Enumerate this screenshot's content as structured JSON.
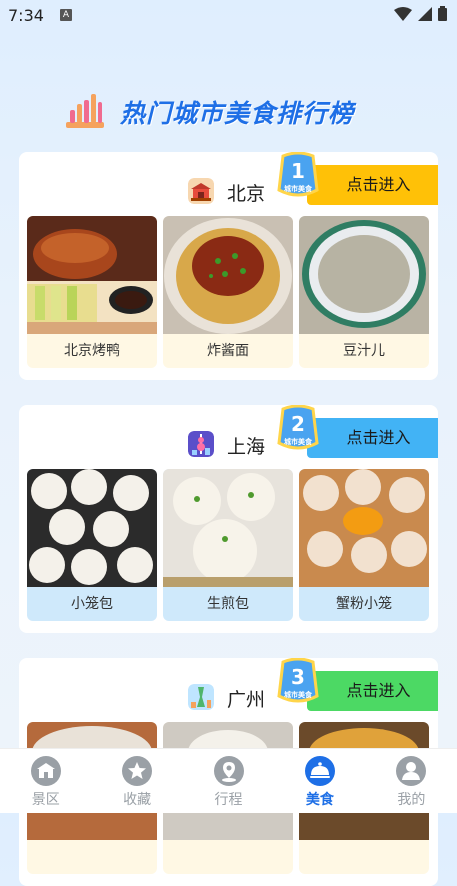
{
  "status": {
    "time": "7:34",
    "notify_glyph": "A"
  },
  "header": {
    "title": "热门城市美食排行榜",
    "icon": "bar-chart-icon"
  },
  "badge_caption": "城市美食",
  "cities": [
    {
      "rank": "1",
      "name": "北京",
      "enter_label": "点击进入",
      "accent": "#ffc107",
      "foods": [
        "北京烤鸭",
        "炸酱面",
        "豆汁儿"
      ]
    },
    {
      "rank": "2",
      "name": "上海",
      "enter_label": "点击进入",
      "accent": "#42b3f5",
      "foods": [
        "小笼包",
        "生煎包",
        "蟹粉小笼"
      ]
    },
    {
      "rank": "3",
      "name": "广州",
      "enter_label": "点击进入",
      "accent": "#4cd964",
      "foods": [
        "",
        "",
        ""
      ]
    }
  ],
  "tabs": [
    {
      "label": "景区",
      "icon": "scenic-icon",
      "active": false
    },
    {
      "label": "收藏",
      "icon": "favorite-icon",
      "active": false
    },
    {
      "label": "行程",
      "icon": "itinerary-icon",
      "active": false
    },
    {
      "label": "美食",
      "icon": "food-cloche-icon",
      "active": true
    },
    {
      "label": "我的",
      "icon": "profile-icon",
      "active": false
    }
  ],
  "colors": {
    "primary": "#1e6fe6",
    "tab_inactive": "#9aa0a6"
  }
}
